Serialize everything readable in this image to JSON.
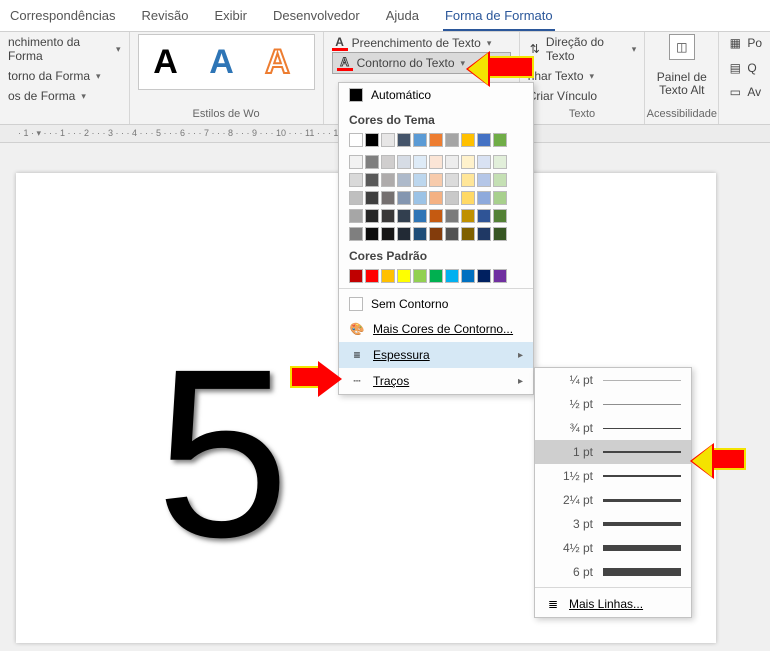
{
  "tabs": {
    "t0": "Correspondências",
    "t1": "Revisão",
    "t2": "Exibir",
    "t3": "Desenvolvedor",
    "t4": "Ajuda",
    "t5": "Forma de Formato"
  },
  "ribbon": {
    "shape_group": {
      "fill": "nchimento da Forma",
      "outline": "torno da Forma",
      "effects": "os de Forma",
      "label": "Estilos de Wo"
    },
    "text_group": {
      "fill": "Preenchimento de Texto",
      "outline": "Contorno do Texto"
    },
    "text2_group": {
      "direction": "Direção do Texto",
      "align": "nhar Texto",
      "link": "Criar Vínculo",
      "label": "Texto"
    },
    "acc_group": {
      "alt": "Painel de Texto Alt",
      "label": "Acessibilidade"
    },
    "arrange_group": {
      "pos": "Po",
      "wrap": "Q",
      "fwd": "Av"
    }
  },
  "dropdown": {
    "auto": "Automático",
    "theme_label": "Cores do Tema",
    "std_label": "Cores Padrão",
    "no_outline": "Sem Contorno",
    "more_colors": "Mais Cores de Contorno...",
    "weight": "Espessura",
    "dashes": "Traços"
  },
  "weights": {
    "w0": "¼ pt",
    "w1": "½ pt",
    "w2": "¾ pt",
    "w3": "1 pt",
    "w4": "1½ pt",
    "w5": "2¼ pt",
    "w6": "3 pt",
    "w7": "4½ pt",
    "w8": "6 pt",
    "more": "Mais Linhas..."
  },
  "doc": {
    "char": "5"
  },
  "theme_row1": [
    "#ffffff",
    "#000000",
    "#e7e6e6",
    "#44546a",
    "#5b9bd5",
    "#ed7d31",
    "#a5a5a5",
    "#ffc000",
    "#4472c4",
    "#70ad47"
  ],
  "theme_shades": [
    [
      "#f2f2f2",
      "#7f7f7f",
      "#d0cece",
      "#d6dce5",
      "#deebf7",
      "#fbe5d6",
      "#ededed",
      "#fff2cc",
      "#d9e2f3",
      "#e2efda"
    ],
    [
      "#d9d9d9",
      "#595959",
      "#aeabab",
      "#adb9ca",
      "#bdd7ee",
      "#f7cbac",
      "#dbdbdb",
      "#ffe699",
      "#b4c6e7",
      "#c5e0b4"
    ],
    [
      "#bfbfbf",
      "#3f3f3f",
      "#757070",
      "#8496b0",
      "#9cc3e6",
      "#f4b183",
      "#c9c9c9",
      "#ffd965",
      "#8eaadc",
      "#a8d08d"
    ],
    [
      "#a6a6a6",
      "#262626",
      "#3a3838",
      "#323f4f",
      "#2e75b6",
      "#c55a11",
      "#7b7b7b",
      "#bf9000",
      "#2f5496",
      "#538135"
    ],
    [
      "#7f7f7f",
      "#0c0c0c",
      "#171616",
      "#222a35",
      "#1f4e79",
      "#833c0c",
      "#525252",
      "#7f6000",
      "#1f3864",
      "#375623"
    ]
  ],
  "std_colors": [
    "#c00000",
    "#ff0000",
    "#ffc000",
    "#ffff00",
    "#92d050",
    "#00b050",
    "#00b0f0",
    "#0070c0",
    "#002060",
    "#7030a0"
  ]
}
